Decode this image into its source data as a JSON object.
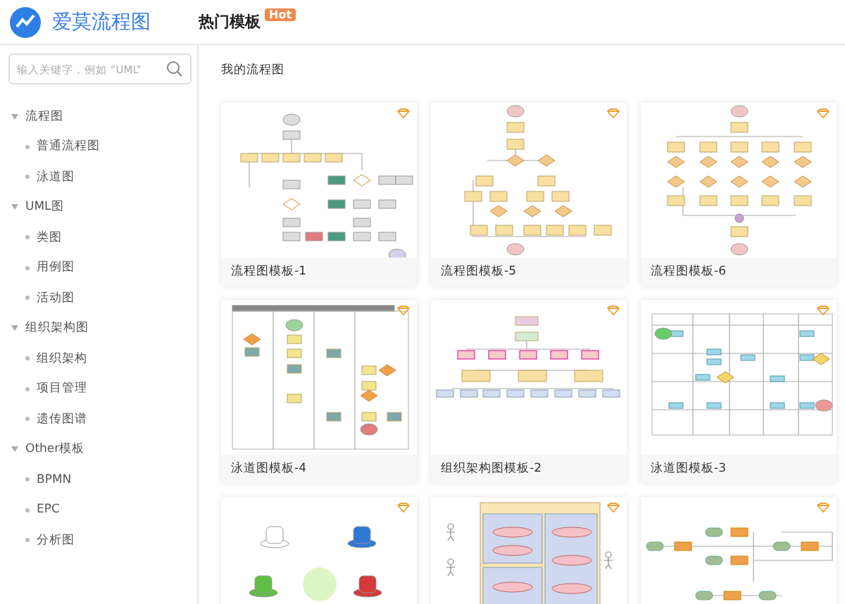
{
  "header": {
    "brand": "爱莫流程图",
    "nav": [
      {
        "label": "热门模板",
        "badge": "Hot"
      }
    ]
  },
  "search": {
    "placeholder": "输入关键字，例如 “UML”"
  },
  "sidebar": {
    "items": [
      {
        "label": "流程图",
        "expanded": true,
        "children": [
          {
            "label": "普通流程图"
          },
          {
            "label": "泳道图"
          }
        ]
      },
      {
        "label": "UML图",
        "expanded": true,
        "children": [
          {
            "label": "类图"
          },
          {
            "label": "用例图"
          },
          {
            "label": "活动图"
          }
        ]
      },
      {
        "label": "组织架构图",
        "expanded": true,
        "children": [
          {
            "label": "组织架构"
          },
          {
            "label": "项目管理"
          },
          {
            "label": "遗传图谱"
          }
        ]
      },
      {
        "label": "Other模板",
        "expanded": true,
        "children": [
          {
            "label": "BPMN"
          },
          {
            "label": "EPC"
          },
          {
            "label": "分析图"
          }
        ]
      }
    ]
  },
  "section_title": "我的流程图",
  "cards": [
    {
      "kind": "flow",
      "title": "流程图模板-1"
    },
    {
      "kind": "tree",
      "title": "流程图模板-5"
    },
    {
      "kind": "columns",
      "title": "流程图模板-6"
    },
    {
      "kind": "swimlane",
      "title": "泳道图模板-4"
    },
    {
      "kind": "org",
      "title": "组织架构图模板-2"
    },
    {
      "kind": "lanes",
      "title": "泳道图模板-3"
    },
    {
      "kind": "hats"
    },
    {
      "kind": "usecase"
    },
    {
      "kind": "process"
    }
  ]
}
